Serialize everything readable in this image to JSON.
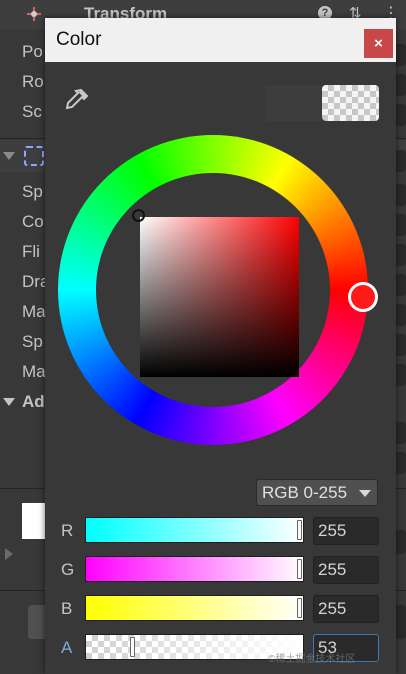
{
  "inspector": {
    "header_title": "Transform",
    "rows_transform": [
      "Po",
      "Ro",
      "Sc"
    ],
    "rows_sprite": [
      "Sp",
      "Co",
      "Fli",
      "Dra",
      "Ma",
      "Sp",
      "Ma"
    ],
    "add_section": "Ad"
  },
  "picker": {
    "title": "Color",
    "close_label": "×",
    "mode": "RGB 0-255",
    "channels": [
      {
        "label": "R",
        "value": "255"
      },
      {
        "label": "G",
        "value": "255"
      },
      {
        "label": "B",
        "value": "255"
      },
      {
        "label": "A",
        "value": "53"
      }
    ],
    "watermark": "©稀土掘金技术社区"
  },
  "colors": {
    "close_button": "#c8484a",
    "window_bg": "#383838",
    "selected_hue": "#ff0000"
  },
  "icons": [
    "eyedropper-icon",
    "help-icon",
    "settings-icon",
    "more-icon"
  ]
}
